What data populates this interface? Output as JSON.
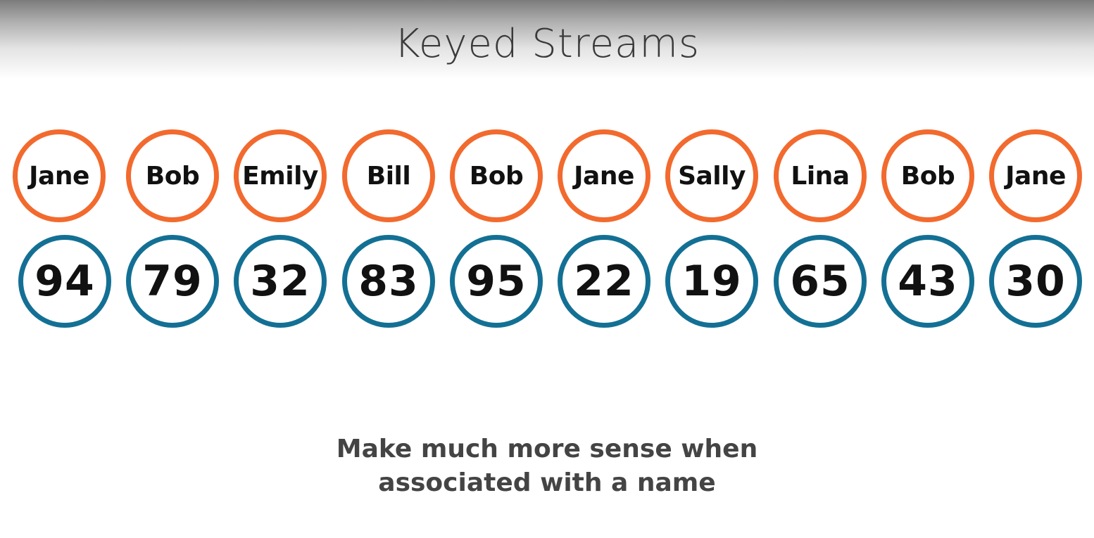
{
  "title": "Keyed Streams",
  "names": [
    "Jane",
    "Bob",
    "Emily",
    "Bill",
    "Bob",
    "Jane",
    "Sally",
    "Lina",
    "Bob",
    "Jane"
  ],
  "values": [
    "94",
    "79",
    "32",
    "83",
    "95",
    "22",
    "19",
    "65",
    "43",
    "30"
  ],
  "caption": {
    "line1": "Make much more sense when",
    "line2": "associated with a name"
  },
  "colors": {
    "name_ring": "#f26a2e",
    "value_ring": "#137094"
  }
}
